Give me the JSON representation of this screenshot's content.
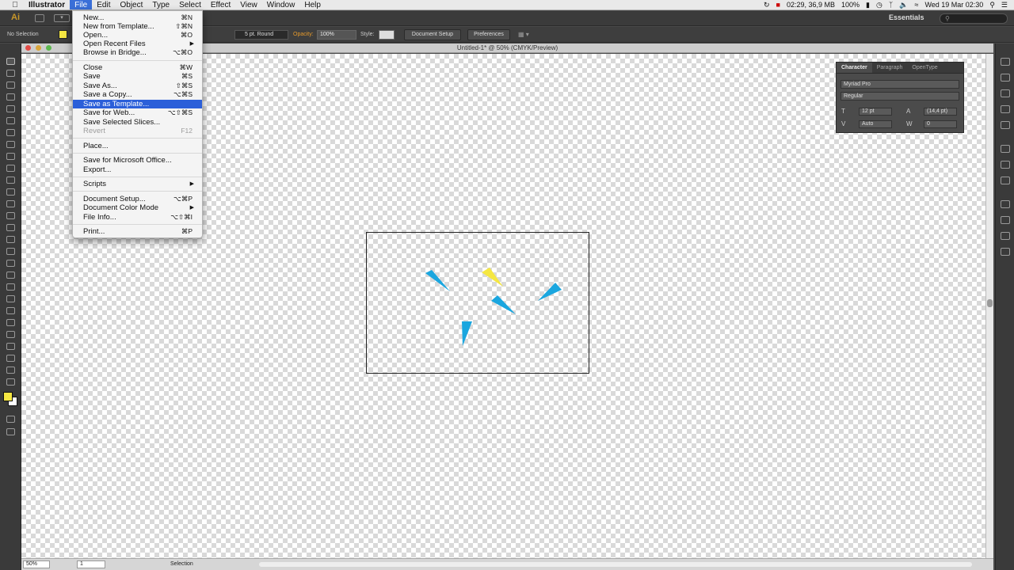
{
  "menubar": {
    "app_name": "Illustrator",
    "menus": [
      "File",
      "Edit",
      "Object",
      "Type",
      "Select",
      "Effect",
      "View",
      "Window",
      "Help"
    ],
    "status": {
      "recording": "02:29, 36,9 MB",
      "battery": "100%",
      "datetime": "Wed 19 Mar  02:30"
    }
  },
  "appbar": {
    "logo": "Ai",
    "workspace": "Essentials",
    "search_placeholder": ""
  },
  "control": {
    "selection_state": "No Selection",
    "fill_color": "#f5e742",
    "stroke_profile": "5 pt. Round",
    "opacity_label": "Opacity:",
    "opacity_value": "100%",
    "style_label": "Style:",
    "document_setup": "Document Setup",
    "preferences": "Preferences"
  },
  "document": {
    "title": "Untitled-1* @ 50% (CMYK/Preview)",
    "zoom": "50%",
    "page": "1",
    "status_mode": "Selection"
  },
  "character_panel": {
    "tabs": [
      "Character",
      "Paragraph",
      "OpenType"
    ],
    "font_family": "Myriad Pro",
    "font_style": "Regular",
    "font_size": "12 pt",
    "leading": "(14,4 pt)",
    "kerning": "Auto",
    "tracking": "0"
  },
  "file_menu": {
    "items": [
      {
        "label": "New...",
        "shortcut": "⌘N"
      },
      {
        "label": "New from Template...",
        "shortcut": "⇧⌘N"
      },
      {
        "label": "Open...",
        "shortcut": "⌘O"
      },
      {
        "label": "Open Recent Files",
        "shortcut": "",
        "submenu": true
      },
      {
        "label": "Browse in Bridge...",
        "shortcut": "⌥⌘O"
      },
      {
        "label": "Close",
        "shortcut": "⌘W"
      },
      {
        "label": "Save",
        "shortcut": "⌘S"
      },
      {
        "label": "Save As...",
        "shortcut": "⇧⌘S"
      },
      {
        "label": "Save a Copy...",
        "shortcut": "⌥⌘S"
      },
      {
        "label": "Save as Template...",
        "shortcut": "",
        "highlighted": true
      },
      {
        "label": "Save for Web...",
        "shortcut": "⌥⇧⌘S"
      },
      {
        "label": "Save Selected Slices...",
        "shortcut": ""
      },
      {
        "label": "Revert",
        "shortcut": "F12",
        "disabled": true
      },
      {
        "label": "Place...",
        "shortcut": ""
      },
      {
        "label": "Save for Microsoft Office...",
        "shortcut": ""
      },
      {
        "label": "Export...",
        "shortcut": ""
      },
      {
        "label": "Scripts",
        "shortcut": "",
        "submenu": true
      },
      {
        "label": "Document Setup...",
        "shortcut": "⌥⌘P"
      },
      {
        "label": "Document Color Mode",
        "shortcut": "",
        "submenu": true
      },
      {
        "label": "File Info...",
        "shortcut": "⌥⇧⌘I"
      },
      {
        "label": "Print...",
        "shortcut": "⌘P"
      }
    ]
  },
  "colors": {
    "highlight": "#2b5fd9",
    "cyan_shape": "#1aa6df",
    "yellow_shape": "#f5e742"
  }
}
